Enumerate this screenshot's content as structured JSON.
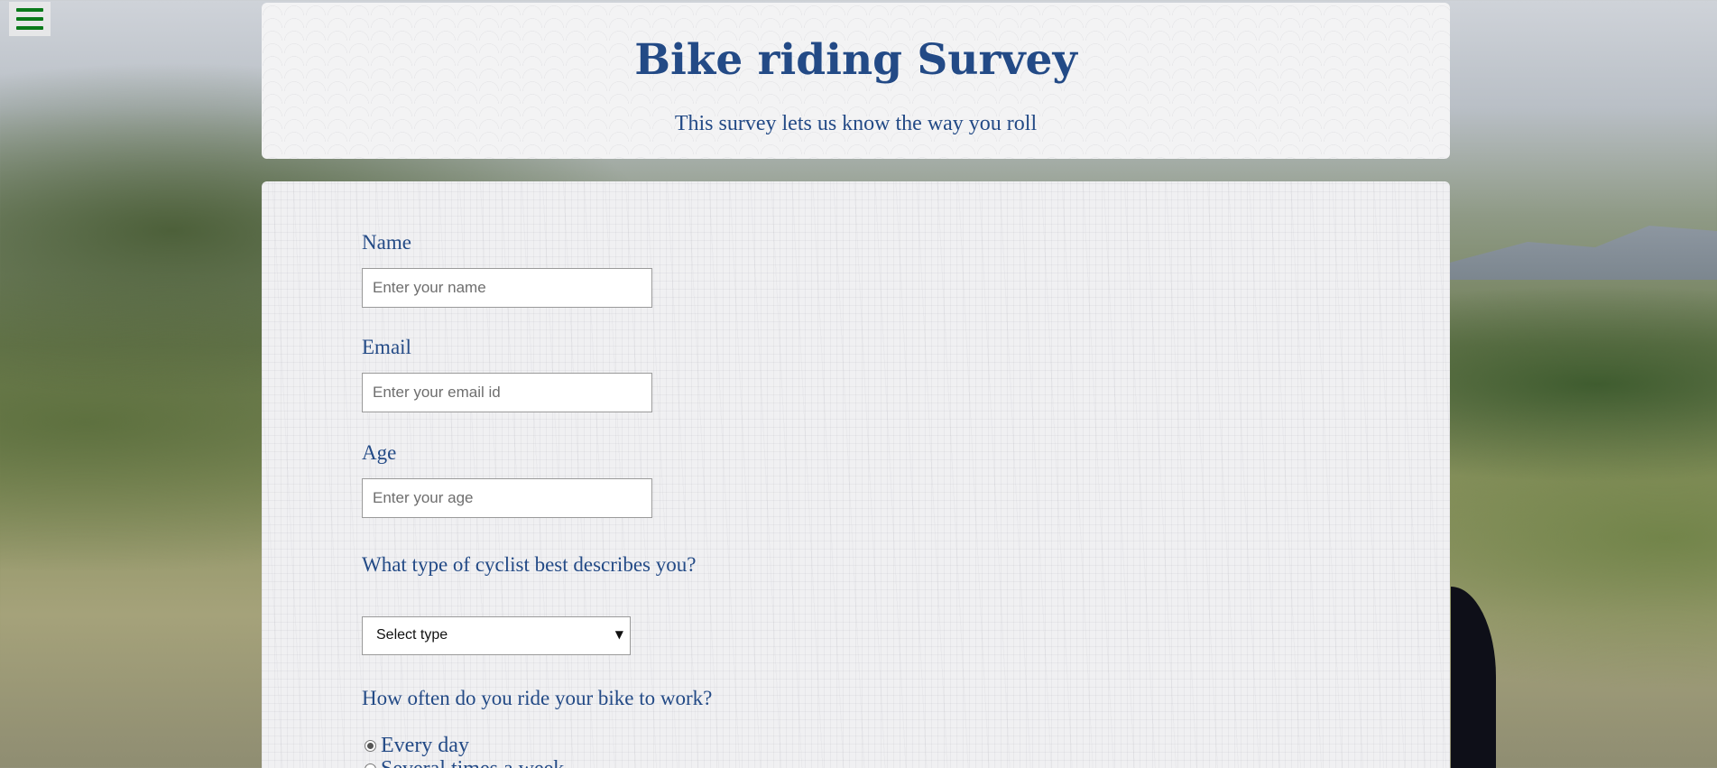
{
  "menu": {
    "icon": "hamburger-menu-icon"
  },
  "header": {
    "title": "Bike riding Survey",
    "subtitle": "This survey lets us know the way you roll"
  },
  "form": {
    "name": {
      "label": "Name",
      "placeholder": "Enter your name"
    },
    "email": {
      "label": "Email",
      "placeholder": "Enter your email id"
    },
    "age": {
      "label": "Age",
      "placeholder": "Enter your age"
    },
    "cyclist_type": {
      "label": "What type of cyclist best describes you?",
      "selected": "Select type"
    },
    "ride_frequency": {
      "label": "How often do you ride your bike to work?",
      "options": [
        {
          "label": "Every day",
          "checked": true
        },
        {
          "label": "Several times a week",
          "checked": false
        }
      ]
    }
  },
  "colors": {
    "accent": "#234a86",
    "menu_icon": "#0a7a1a"
  }
}
